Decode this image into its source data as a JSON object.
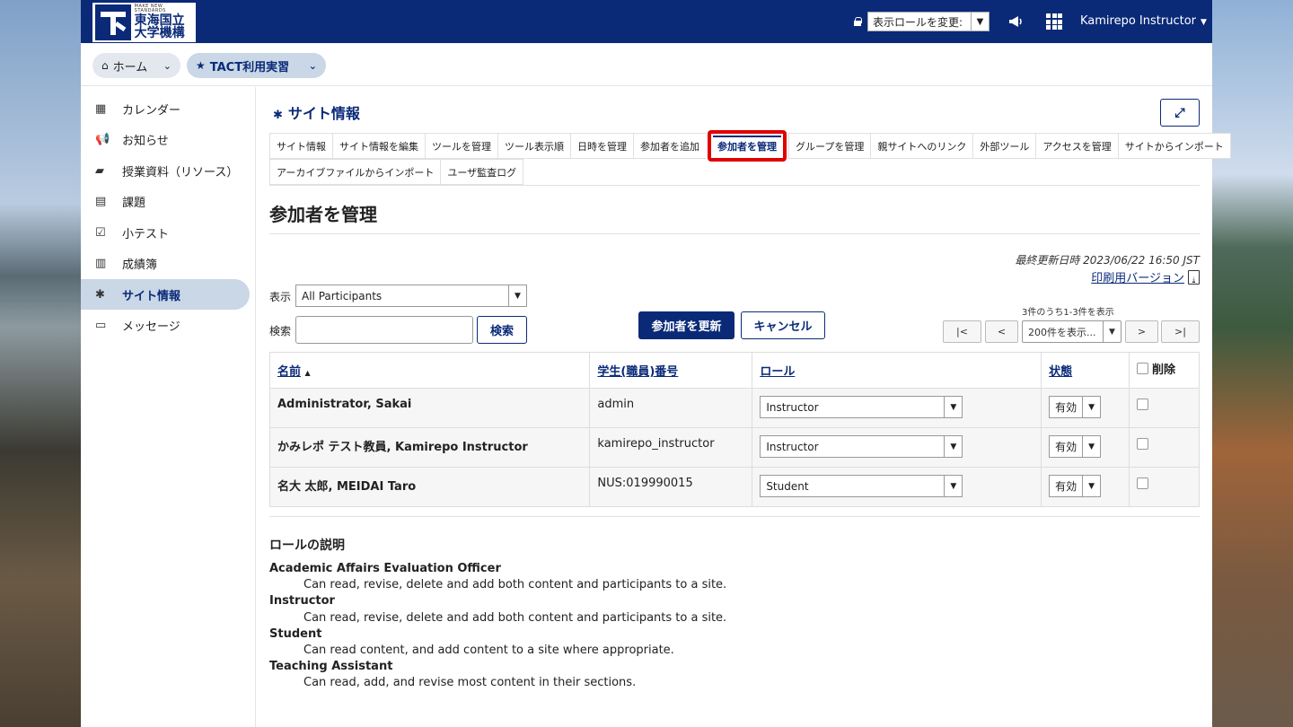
{
  "header": {
    "logo_small": "MAKE NEW STANDARDS",
    "logo_line1": "東海国立",
    "logo_line2": "大学機構",
    "role_switch_value": "表示ロールを変更:",
    "user_name": "Kamirepo Instructor",
    "brand_color": "#0a2a78"
  },
  "breadcrumb": {
    "home_label": "ホーム",
    "site_label": "TACT利用実習"
  },
  "sidebar": {
    "items": [
      {
        "label": "カレンダー",
        "icon": "calendar-icon"
      },
      {
        "label": "お知らせ",
        "icon": "megaphone-icon"
      },
      {
        "label": "授業資料（リソース）",
        "icon": "folder-icon"
      },
      {
        "label": "課題",
        "icon": "document-icon"
      },
      {
        "label": "小テスト",
        "icon": "checkbox-icon"
      },
      {
        "label": "成績簿",
        "icon": "book-icon"
      },
      {
        "label": "サイト情報",
        "icon": "gear-icon"
      },
      {
        "label": "メッセージ",
        "icon": "inbox-icon"
      }
    ],
    "active_index": 6
  },
  "tool": {
    "title": "サイト情報",
    "tabs_row1": [
      "サイト情報",
      "サイト情報を編集",
      "ツールを管理",
      "ツール表示順",
      "日時を管理",
      "参加者を追加",
      "参加者を管理",
      "グループを管理",
      "親サイトへのリンク",
      "外部ツール",
      "アクセスを管理",
      "サイトからインポート"
    ],
    "tabs_row2": [
      "アーカイブファイルからインポート",
      "ユーザ監査ログ"
    ],
    "active_tab": "参加者を管理",
    "highlight_color": "#e00000"
  },
  "page": {
    "heading": "参加者を管理",
    "last_modified": "最終更新日時 2023/06/22 16:50 JST",
    "print_link": "印刷用バージョン",
    "show_label": "表示",
    "show_value": "All Participants",
    "search_label": "検索",
    "search_value": "",
    "search_button": "検索",
    "update_button": "参加者を更新",
    "cancel_button": "キャンセル",
    "count_text": "3件のうち1-3件を表示",
    "page_size": "200件を表示...",
    "pager": {
      "first": "|<",
      "prev": "<",
      "next": ">",
      "last": ">|"
    }
  },
  "table": {
    "headers": {
      "name": "名前",
      "sort_indicator": "▲",
      "id": "学生(職員)番号",
      "role": "ロール",
      "status": "状態",
      "delete": "削除"
    },
    "rows": [
      {
        "name": "Administrator, Sakai",
        "id": "admin",
        "role": "Instructor",
        "status": "有効"
      },
      {
        "name": "かみレポ テスト教員, Kamirepo Instructor",
        "id": "kamirepo_instructor",
        "role": "Instructor",
        "status": "有効"
      },
      {
        "name": "名大 太郎, MEIDAI Taro",
        "id": "NUS:019990015",
        "role": "Student",
        "status": "有効"
      }
    ]
  },
  "roles": {
    "title": "ロールの説明",
    "items": [
      {
        "name": "Academic Affairs Evaluation Officer",
        "desc": "Can read, revise, delete and add both content and participants to a site."
      },
      {
        "name": "Instructor",
        "desc": "Can read, revise, delete and add both content and participants to a site."
      },
      {
        "name": "Student",
        "desc": "Can read content, and add content to a site where appropriate."
      },
      {
        "name": "Teaching Assistant",
        "desc": "Can read, add, and revise most content in their sections."
      }
    ]
  }
}
